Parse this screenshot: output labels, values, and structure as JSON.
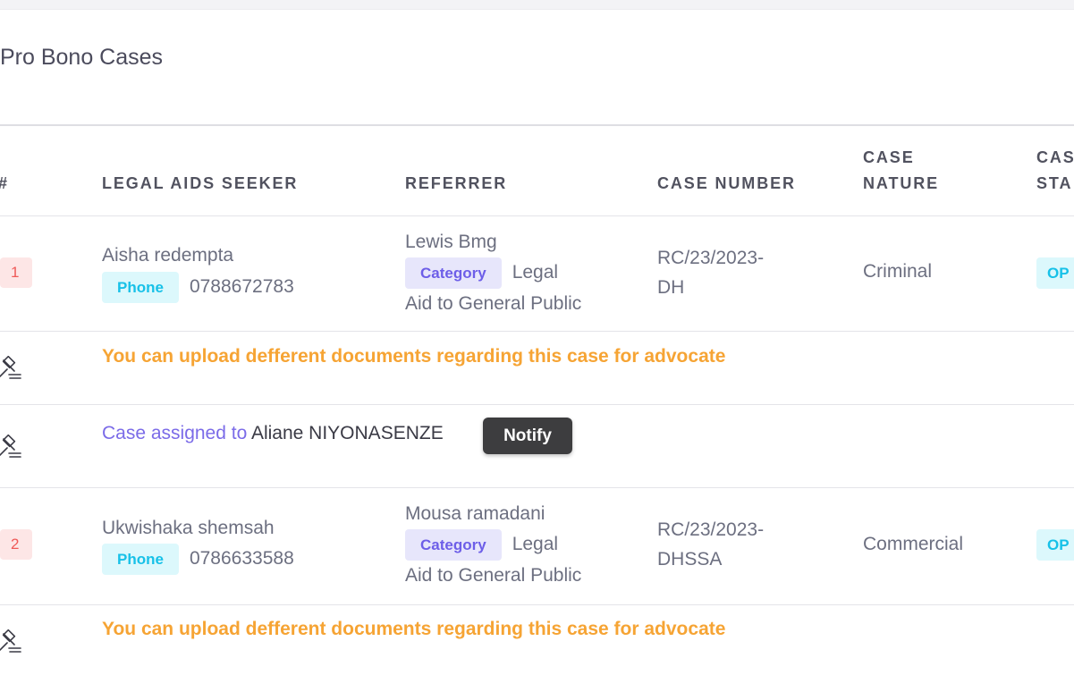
{
  "card": {
    "title": "Pro Bono Cases"
  },
  "columns": {
    "index": "#",
    "seeker": "LEGAL AIDS SEEKER",
    "referrer": "REFERRER",
    "case_number": "CASE NUMBER",
    "case_nature_1": "CASE",
    "case_nature_2": "NATURE",
    "case_status_1": "CAS",
    "case_status_2": "STA"
  },
  "rows": [
    {
      "index": "1",
      "seeker_name": "Aisha redempta",
      "phone_label": "Phone",
      "phone": "0788672783",
      "referrer_name": "Lewis Bmg",
      "category_label": "Category",
      "category_value_1": "Legal",
      "category_value_2": "Aid to General Public",
      "case_number_1": "RC/23/2023-",
      "case_number_2": "DH",
      "case_nature": "Criminal",
      "status": "OP",
      "upload_note": "You can upload defferent documents regarding this case for advocate",
      "assigned_label": "Case assigned to",
      "assigned_to": "Aliane NIYONASENZE",
      "notify_label": "Notify"
    },
    {
      "index": "2",
      "seeker_name": "Ukwishaka shemsah",
      "phone_label": "Phone",
      "phone": "0786633588",
      "referrer_name": "Mousa ramadani",
      "category_label": "Category",
      "category_value_1": "Legal",
      "category_value_2": "Aid to General Public",
      "case_number_1": "RC/23/2023-",
      "case_number_2": "DHSSA",
      "case_nature": "Commercial",
      "status": "OP",
      "upload_note": "You can upload defferent documents regarding this case for advocate"
    }
  ],
  "colors": {
    "accent_orange": "#f6a434",
    "accent_purple": "#7b6be8",
    "phone_pill": "#17c1e8",
    "index_badge": "#ef5a58"
  },
  "icons": {
    "action": "gavel-icon"
  }
}
